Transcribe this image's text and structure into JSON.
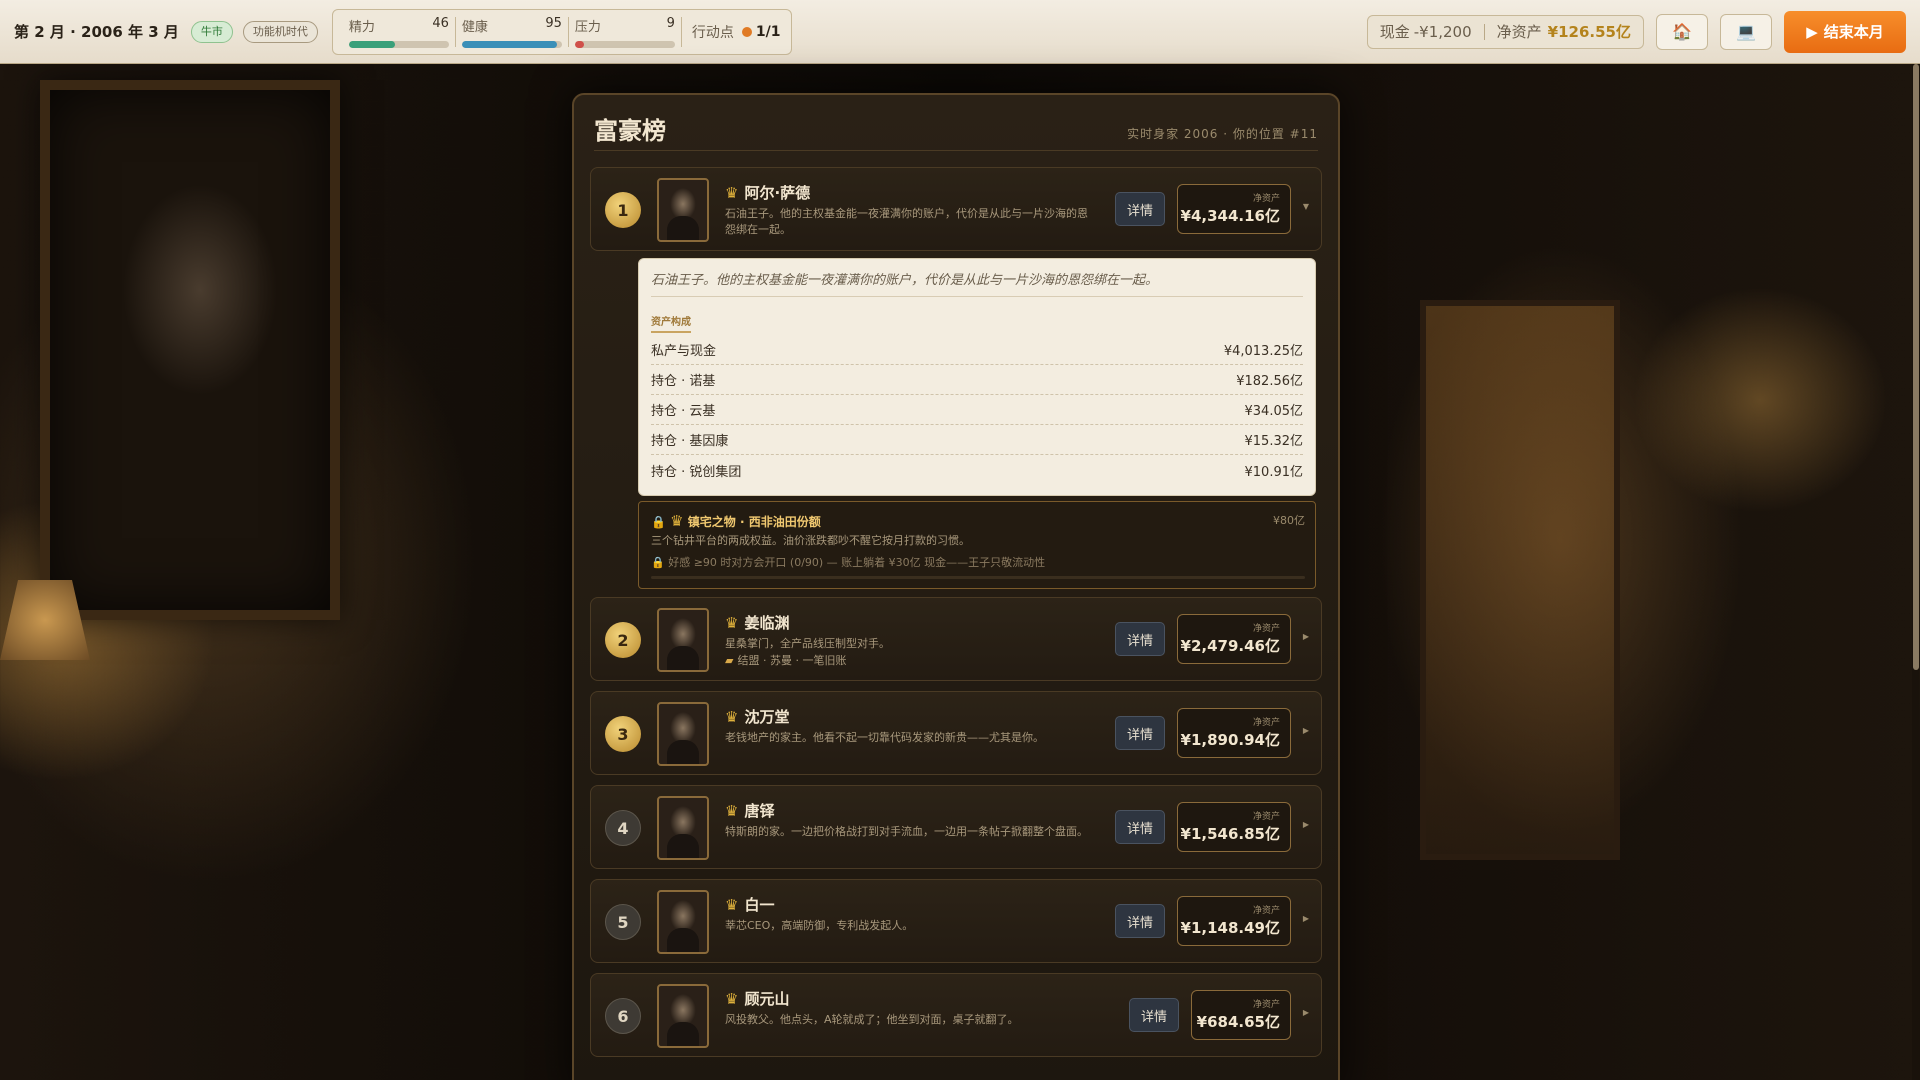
{
  "topbar": {
    "date": "第 2 月 · 2006 年 3 月",
    "market_tag": "牛市",
    "era_tag": "功能机时代",
    "stats": [
      {
        "label": "精力",
        "value": "46",
        "level": 0.46,
        "color": "#3aa07a"
      },
      {
        "label": "健康",
        "value": "95",
        "level": 0.95,
        "color": "#3a8fb8"
      },
      {
        "label": "压力",
        "value": "9",
        "level": 0.09,
        "color": "#d0504a"
      }
    ],
    "action_label": "行动点",
    "action_value": "1/1",
    "cash_label": "现金",
    "cash_value": "-¥1,200",
    "networth_label": "净资产",
    "networth_value": "¥126.55亿",
    "home_icon": "🏠",
    "computer_icon": "💻",
    "end_month_label": "结束本月"
  },
  "panel": {
    "title": "富豪榜",
    "subtitle": "实时身家 2006 · 你的位置 #11",
    "detail_label": "详情",
    "networth_label": "净资产",
    "rows": [
      {
        "rank": "1",
        "name": "阿尔·萨德",
        "desc": "石油王子。他的主权基金能一夜灌满你的账户，代价是从此与一片沙海的恩怨绑在一起。",
        "networth": "¥4,344.16亿"
      },
      {
        "rank": "2",
        "name": "姜临渊",
        "desc": "星桑掌门，全产品线压制型对手。",
        "tag": "结盟 · 苏曼 · 一笔旧账",
        "networth": "¥2,479.46亿"
      },
      {
        "rank": "3",
        "name": "沈万堂",
        "desc": "老钱地产的家主。他看不起一切靠代码发家的新贵——尤其是你。",
        "networth": "¥1,890.94亿"
      },
      {
        "rank": "4",
        "name": "唐铎",
        "desc": "特斯朗的家。一边把价格战打到对手流血，一边用一条帖子掀翻整个盘面。",
        "networth": "¥1,546.85亿"
      },
      {
        "rank": "5",
        "name": "白一",
        "desc": "莘芯CEO，高端防御，专利战发起人。",
        "networth": "¥1,148.49亿"
      },
      {
        "rank": "6",
        "name": "顾元山",
        "desc": "风投教父。他点头，A轮就成了；他坐到对面，桌子就翻了。",
        "networth": "¥684.65亿"
      }
    ],
    "expanded": {
      "quote": "石油王子。他的主权基金能一夜灌满你的账户，代价是从此与一片沙海的恩怨绑在一起。",
      "section_title": "资产构成",
      "assets": [
        {
          "label": "私产与现金",
          "value": "¥4,013.25亿"
        },
        {
          "label": "持仓 · 诺基",
          "value": "¥182.56亿"
        },
        {
          "label": "持仓 · 云基",
          "value": "¥34.05亿"
        },
        {
          "label": "持仓 · 基因康",
          "value": "¥15.32亿"
        },
        {
          "label": "持仓 · 锐创集团",
          "value": "¥10.91亿"
        }
      ],
      "treasure": {
        "title": "镇宅之物 · 西非油田份额",
        "value": "¥80亿",
        "desc": "三个钻井平台的两成权益。油价涨跌都吵不醒它按月打款的习惯。",
        "condition": "好感 ≥90 时对方会开口 (0/90) — 账上躺着 ¥30亿 现金——王子只敬流动性"
      }
    }
  }
}
